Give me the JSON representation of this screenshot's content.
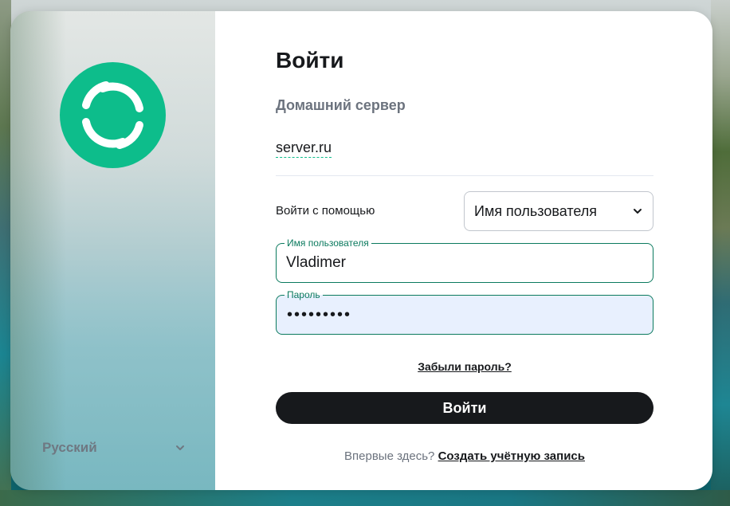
{
  "auth": {
    "title": "Войти",
    "homeserver_label": "Домашний сервер",
    "homeserver_value": "server.ru",
    "signin_with_label": "Войти с помощью",
    "signin_method": "Имя пользователя",
    "username_label": "Имя пользователя",
    "username_value": "Vladimer",
    "password_label": "Пароль",
    "password_masked": "•••••••••",
    "forgot_password": "Забыли пароль?",
    "submit_label": "Войти",
    "new_here": "Впервые здесь?",
    "create_account": "Создать учётную запись"
  },
  "sidebar": {
    "language": "Русский",
    "logo_icon": "element-logo-icon"
  },
  "colors": {
    "accent": "#0dbd8b",
    "logo_bg": "#0dbd8b",
    "field_border": "#0b7a5e",
    "button_bg": "#17191c",
    "autofill_bg": "#e8f0fe"
  }
}
